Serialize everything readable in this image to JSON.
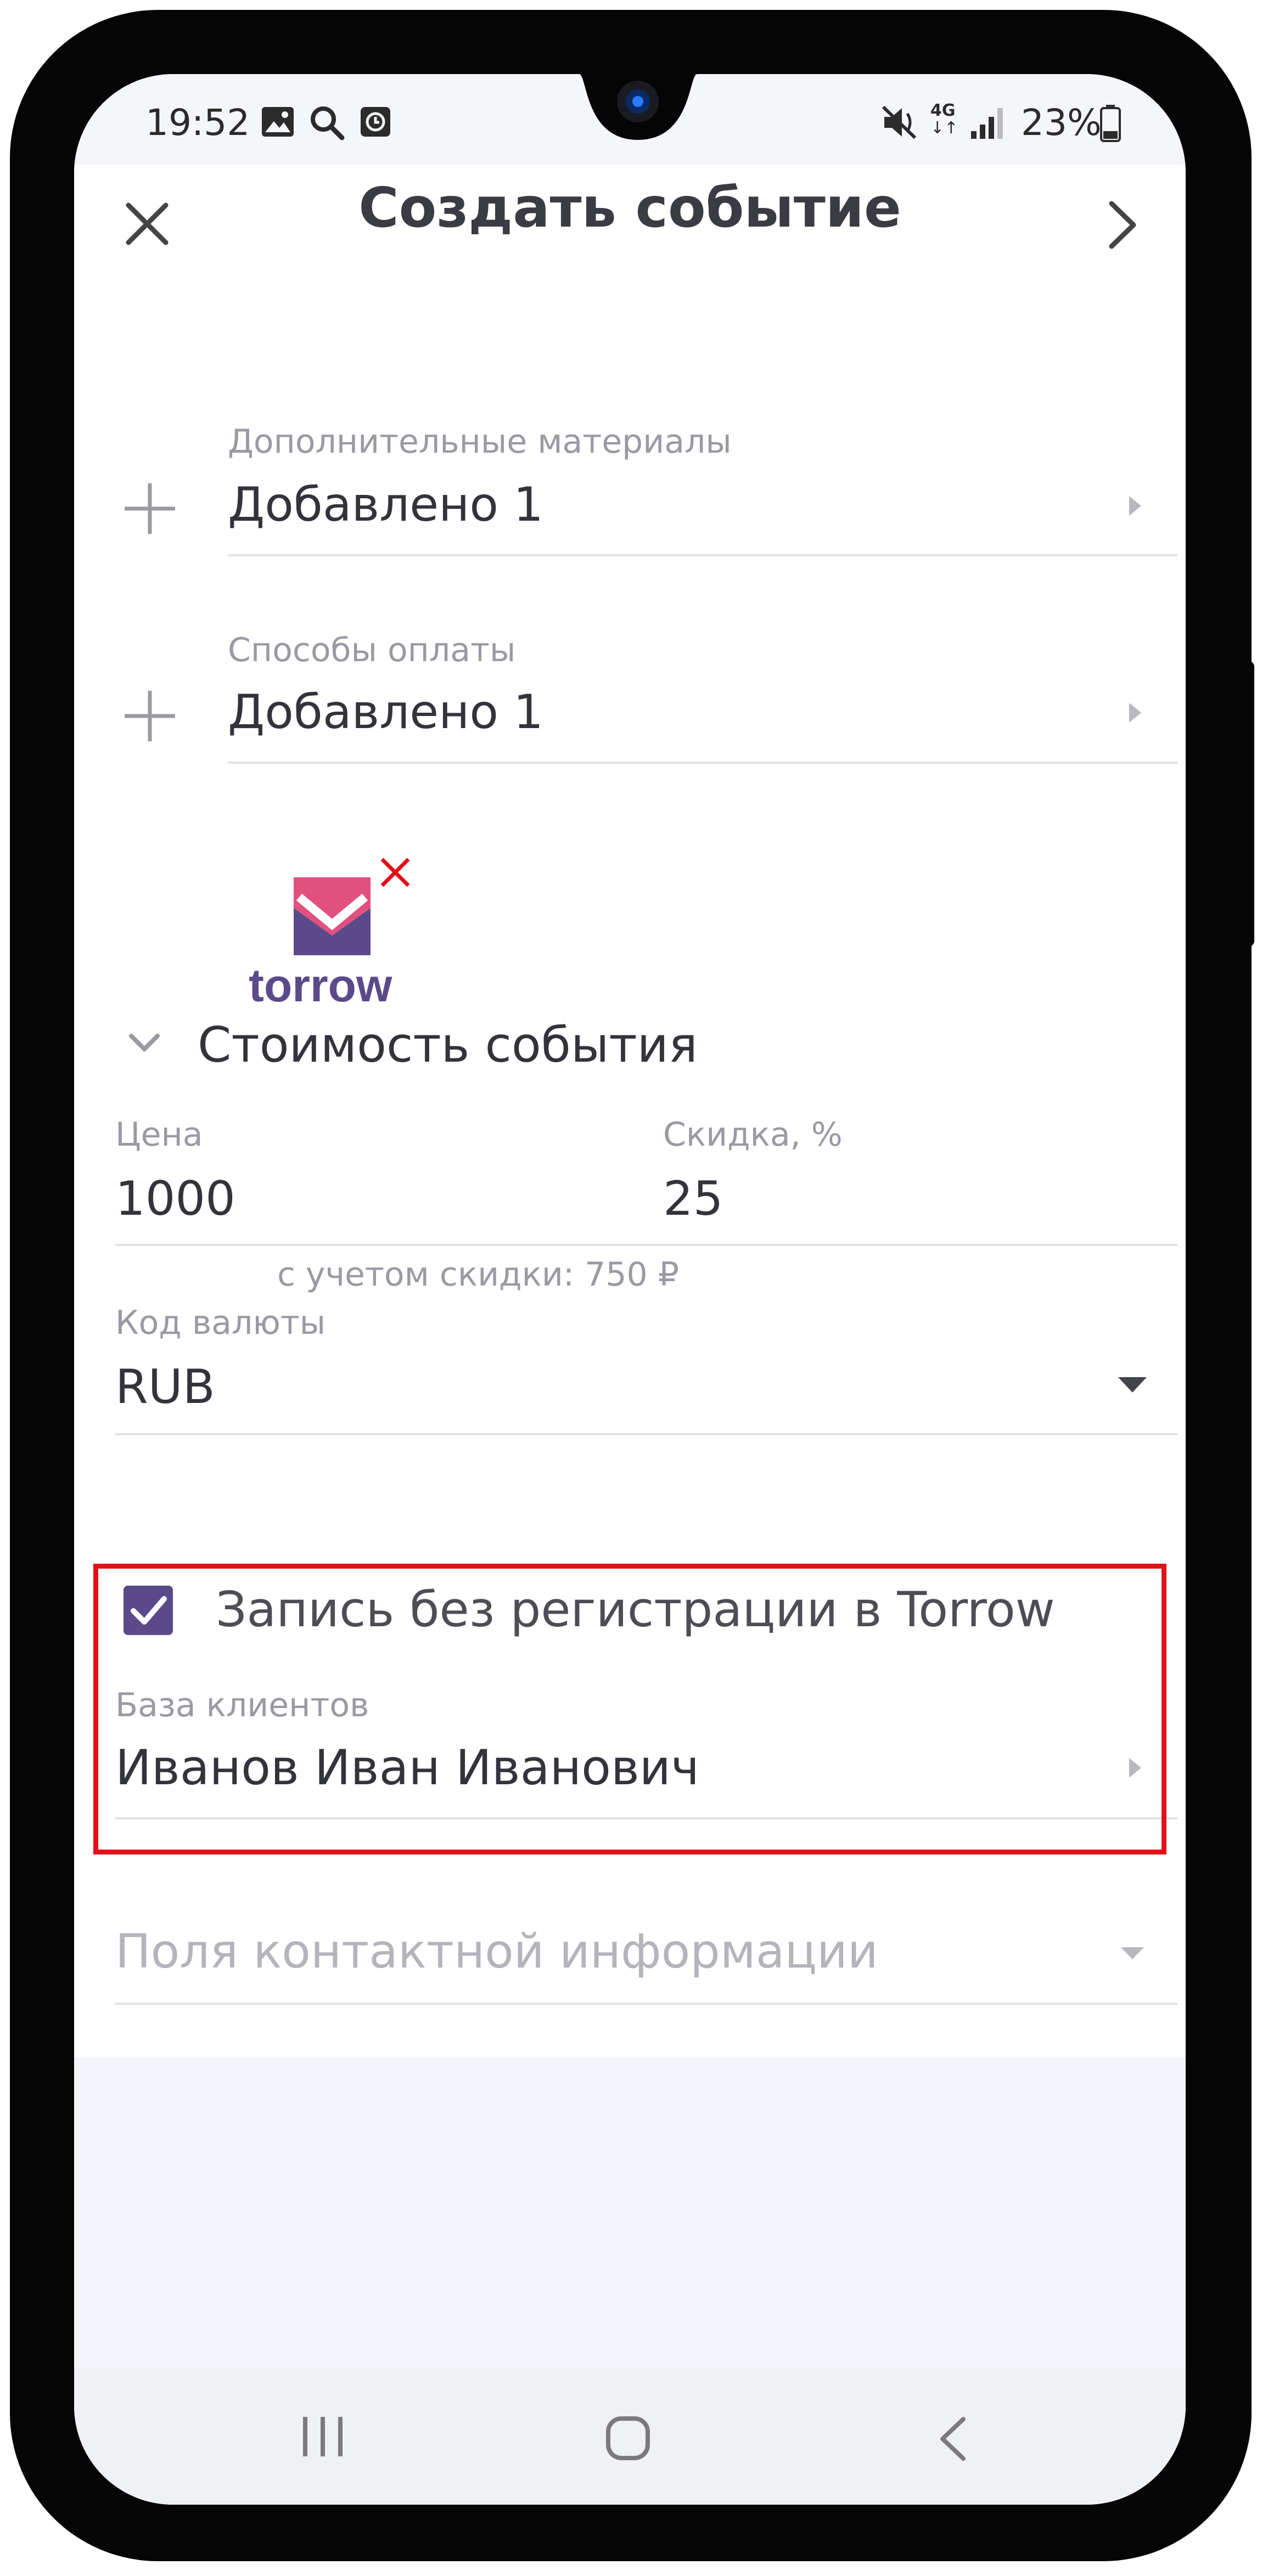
{
  "status_bar": {
    "time": "19:52",
    "network": "4G",
    "battery_percent": "23%",
    "left_icons": [
      "image-icon",
      "search-icon",
      "clock-icon"
    ],
    "right_icons": [
      "mute-icon",
      "network-4g-icon",
      "signal-icon",
      "battery-icon"
    ]
  },
  "header": {
    "title": "Создать событие",
    "close_icon": "close-icon",
    "next_icon": "chevron-right-icon"
  },
  "form": {
    "materials": {
      "label": "Дополнительные материалы",
      "value": "Добавлено 1"
    },
    "payments": {
      "label": "Способы оплаты",
      "value": "Добавлено 1"
    },
    "logo": {
      "brand": "torrow"
    },
    "cost_section": {
      "title": "Стоимость события"
    },
    "price": {
      "label": "Цена",
      "value": "1000"
    },
    "discount": {
      "label": "Скидка, %",
      "value": "25"
    },
    "discount_note": "с учетом скидки: 750 ₽",
    "currency": {
      "label": "Код валюты",
      "value": "RUB"
    },
    "no_registration": {
      "label": "Запись без регистрации в Torrow",
      "checked": true
    },
    "client_base": {
      "label": "База клиентов",
      "value": "Иванов Иван Иванович"
    },
    "contact_fields": {
      "placeholder": "Поля контактной информации"
    }
  },
  "colors": {
    "highlight_border": "#e01218",
    "checkbox": "#5b4a8a",
    "logo_pink": "#e2507f",
    "logo_purple": "#5b4a8a"
  }
}
